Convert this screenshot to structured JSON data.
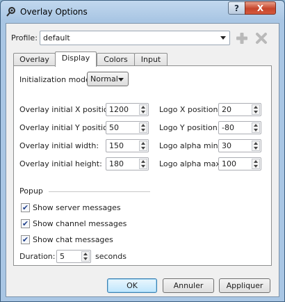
{
  "window": {
    "title": "Overlay Options",
    "help_label": "?",
    "close_label": "X"
  },
  "profile": {
    "label": "Profile:",
    "value": "default"
  },
  "tabs": [
    {
      "label": "Overlay"
    },
    {
      "label": "Display"
    },
    {
      "label": "Colors"
    },
    {
      "label": "Input"
    }
  ],
  "display": {
    "init_mode_label": "Initialization mode:",
    "init_mode_value": "Normal",
    "left_fields": [
      {
        "label": "Overlay initial X position:",
        "value": "1200"
      },
      {
        "label": "Overlay initial Y position:",
        "value": "50"
      },
      {
        "label": "Overlay initial width:",
        "value": "150"
      },
      {
        "label": "Overlay initial height:",
        "value": "180"
      }
    ],
    "right_fields": [
      {
        "label": "Logo X position:",
        "value": "20"
      },
      {
        "label": "Logo Y position:",
        "value": "-80"
      },
      {
        "label": "Logo alpha min:",
        "value": "30"
      },
      {
        "label": "Logo alpha max:",
        "value": "100"
      }
    ],
    "popup": {
      "heading": "Popup",
      "checkboxes": [
        {
          "label": "Show server messages",
          "checked": true
        },
        {
          "label": "Show channel messages",
          "checked": true
        },
        {
          "label": "Show chat messages",
          "checked": true
        }
      ],
      "duration_label": "Duration:",
      "duration_value": "5",
      "duration_unit": "seconds"
    }
  },
  "buttons": {
    "ok": "OK",
    "cancel": "Annuler",
    "apply": "Appliquer"
  },
  "icons": {
    "add": "plus-icon",
    "delete": "x-icon",
    "app": "gear-icon"
  }
}
